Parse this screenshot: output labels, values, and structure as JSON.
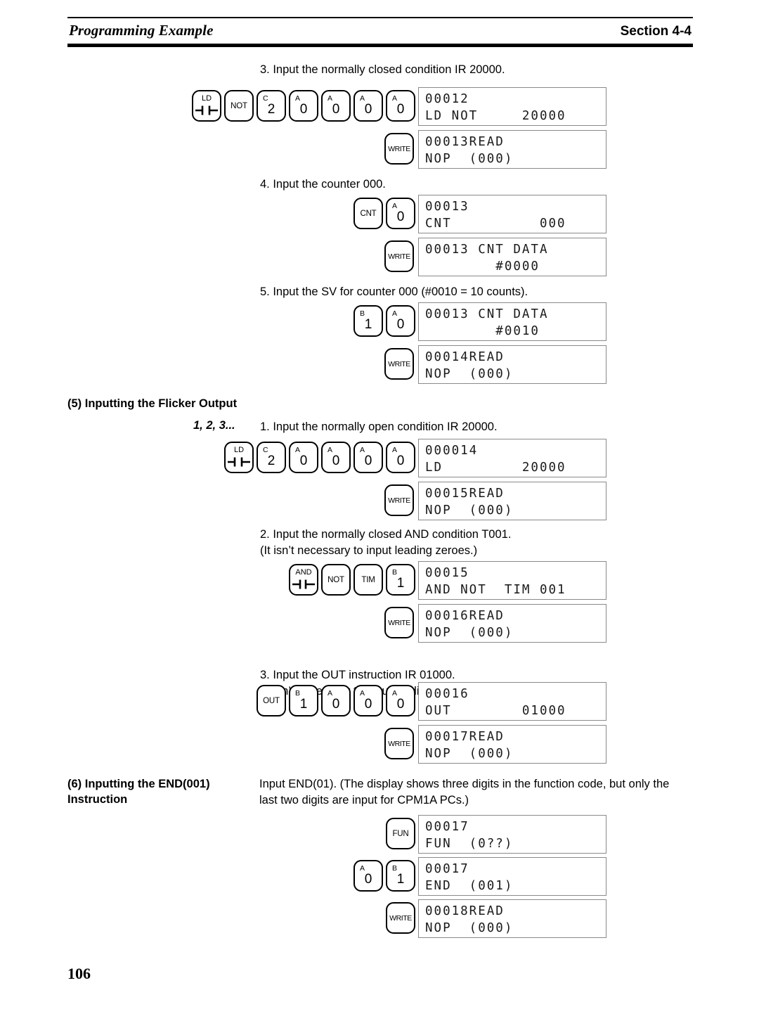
{
  "header": {
    "left_title": "Programming Example",
    "right_title": "Section 4-4"
  },
  "page_number": "106",
  "steps": [
    {
      "id": "step-3-nc-ir20000",
      "text": "3. Input the normally closed condition IR 20000.",
      "keys": [
        {
          "name": "ld-key",
          "type": "glyph",
          "top": "LD",
          "glyph": "nc-contact"
        },
        {
          "name": "not-key",
          "type": "word",
          "label": "NOT"
        },
        {
          "name": "key-c-2",
          "type": "digit",
          "sup": "C",
          "digit": "2"
        },
        {
          "name": "key-a-0-1",
          "type": "digit",
          "sup": "A",
          "digit": "0"
        },
        {
          "name": "key-a-0-2",
          "type": "digit",
          "sup": "A",
          "digit": "0"
        },
        {
          "name": "key-a-0-3",
          "type": "digit",
          "sup": "A",
          "digit": "0"
        },
        {
          "name": "key-a-0-4",
          "type": "digit",
          "sup": "A",
          "digit": "0"
        }
      ],
      "display": {
        "line1": "00012",
        "line2": "LD NOT     20000"
      },
      "write": {
        "key_label": "WRITE",
        "display": {
          "line1": "00013READ",
          "line2": "NOP  (000)"
        }
      }
    },
    {
      "id": "step-4-counter-000",
      "text": "4. Input the counter 000.",
      "keys": [
        {
          "name": "cnt-key",
          "type": "word",
          "label": "CNT"
        },
        {
          "name": "key-a-0-1",
          "type": "digit",
          "sup": "A",
          "digit": "0"
        }
      ],
      "display": {
        "line1": "00013",
        "line2": "CNT          000"
      },
      "write": {
        "key_label": "WRITE",
        "display": {
          "line1": "00013 CNT DATA",
          "line2": "        #0000"
        }
      }
    },
    {
      "id": "step-5-sv-counter-000",
      "text": "5. Input the SV for counter 000 (#0010 = 10 counts).",
      "keys": [
        {
          "name": "key-b-1",
          "type": "digit",
          "sup": "B",
          "digit": "1"
        },
        {
          "name": "key-a-0-1",
          "type": "digit",
          "sup": "A",
          "digit": "0"
        }
      ],
      "display": {
        "line1": "00013 CNT DATA",
        "line2": "        #0010"
      },
      "write": {
        "key_label": "WRITE",
        "display": {
          "line1": "00014READ",
          "line2": "NOP  (000)"
        }
      }
    }
  ],
  "section5": {
    "heading": "(5) Inputting the Flicker Output",
    "list_marker": "1, 2, 3...",
    "steps": [
      {
        "id": "flicker-step-1-no-ir20000",
        "text": "1. Input the normally open condition IR 20000.",
        "keys": [
          {
            "name": "ld-key",
            "type": "glyph",
            "top": "LD",
            "glyph": "nc-contact"
          },
          {
            "name": "key-c-2",
            "type": "digit",
            "sup": "C",
            "digit": "2"
          },
          {
            "name": "key-a-0-1",
            "type": "digit",
            "sup": "A",
            "digit": "0"
          },
          {
            "name": "key-a-0-2",
            "type": "digit",
            "sup": "A",
            "digit": "0"
          },
          {
            "name": "key-a-0-3",
            "type": "digit",
            "sup": "A",
            "digit": "0"
          },
          {
            "name": "key-a-0-4",
            "type": "digit",
            "sup": "A",
            "digit": "0"
          }
        ],
        "display": {
          "line1": "000014",
          "line2": "LD         20000"
        },
        "write": {
          "key_label": "WRITE",
          "display": {
            "line1": "00015READ",
            "line2": "NOP  (000)"
          }
        }
      },
      {
        "id": "flicker-step-2-and-not-t001",
        "text": "2. Input the normally closed AND condition T001.\n    (It isn’t necessary to input leading zeroes.)",
        "keys": [
          {
            "name": "and-key",
            "type": "glyph",
            "top": "AND",
            "glyph": "no-contact"
          },
          {
            "name": "not-key",
            "type": "word",
            "label": "NOT"
          },
          {
            "name": "tim-key",
            "type": "word",
            "label": "TIM"
          },
          {
            "name": "key-b-1",
            "type": "digit",
            "sup": "B",
            "digit": "1"
          }
        ],
        "display": {
          "line1": "00015",
          "line2": "AND NOT  TIM 001"
        },
        "write": {
          "key_label": "WRITE",
          "display": {
            "line1": "00016READ",
            "line2": "NOP  (000)"
          }
        }
      },
      {
        "id": "flicker-step-3-out-ir01000",
        "text": "3. Input the OUT instruction IR 01000.\n    (It isn’t necessary to input leading zeroes.)",
        "keys": [
          {
            "name": "out-key",
            "type": "word",
            "label": "OUT"
          },
          {
            "name": "key-b-1",
            "type": "digit",
            "sup": "B",
            "digit": "1"
          },
          {
            "name": "key-a-0-1",
            "type": "digit",
            "sup": "A",
            "digit": "0"
          },
          {
            "name": "key-a-0-2",
            "type": "digit",
            "sup": "A",
            "digit": "0"
          },
          {
            "name": "key-a-0-3",
            "type": "digit",
            "sup": "A",
            "digit": "0"
          }
        ],
        "display": {
          "line1": "00016",
          "line2": "OUT        01000"
        },
        "write": {
          "key_label": "WRITE",
          "display": {
            "line1": "00017READ",
            "line2": "NOP  (000)"
          }
        }
      }
    ]
  },
  "section6": {
    "heading": "(6) Inputting the END(001)\nInstruction",
    "body": "Input END(01). (The display shows three digits in the function code, but only the\nlast two digits are input for CPM1A PCs.)",
    "rows": [
      {
        "id": "end-row-fun",
        "keys": [
          {
            "name": "fun-key",
            "type": "word",
            "label": "FUN"
          }
        ],
        "display": {
          "line1": "00017",
          "line2": "FUN  (0??)"
        }
      },
      {
        "id": "end-row-01",
        "keys": [
          {
            "name": "key-a-0",
            "type": "digit",
            "sup": "A",
            "digit": "0"
          },
          {
            "name": "key-b-1",
            "type": "digit",
            "sup": "B",
            "digit": "1"
          }
        ],
        "display": {
          "line1": "00017",
          "line2": "END  (001)"
        }
      },
      {
        "id": "end-row-write",
        "keys": [
          {
            "name": "write-key",
            "type": "word",
            "label": "WRITE"
          }
        ],
        "display": {
          "line1": "00018READ",
          "line2": "NOP  (000)"
        }
      }
    ]
  }
}
